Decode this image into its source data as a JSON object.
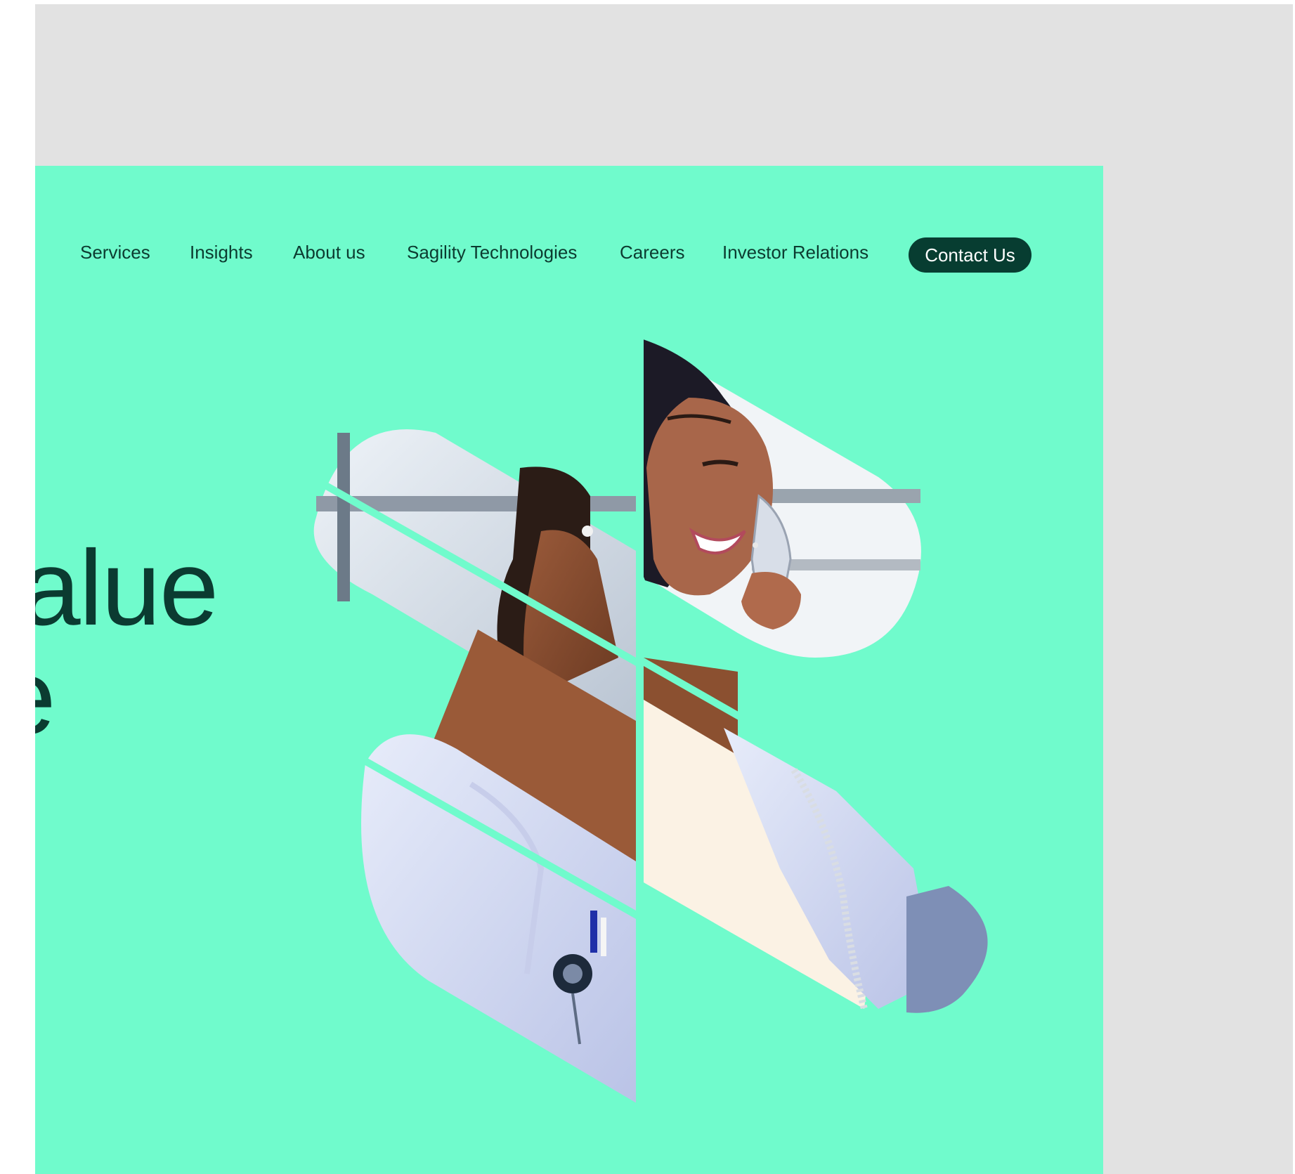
{
  "nav": {
    "items": [
      {
        "id": "services",
        "label": "Services"
      },
      {
        "id": "insights",
        "label": "Insights"
      },
      {
        "id": "about",
        "label": "About us"
      },
      {
        "id": "tech",
        "label": "Sagility Technologies"
      },
      {
        "id": "careers",
        "label": "Careers"
      },
      {
        "id": "investor",
        "label": "Investor Relations"
      }
    ],
    "cta_label": "Contact Us"
  },
  "hero": {
    "line1": "alue",
    "line2": "e",
    "image_icon": "healthcare-agent-photo",
    "colors": {
      "background": "#70fbcc",
      "text": "#0b3b31",
      "cta": "#073d31",
      "frame": "#e2e2e2"
    }
  }
}
